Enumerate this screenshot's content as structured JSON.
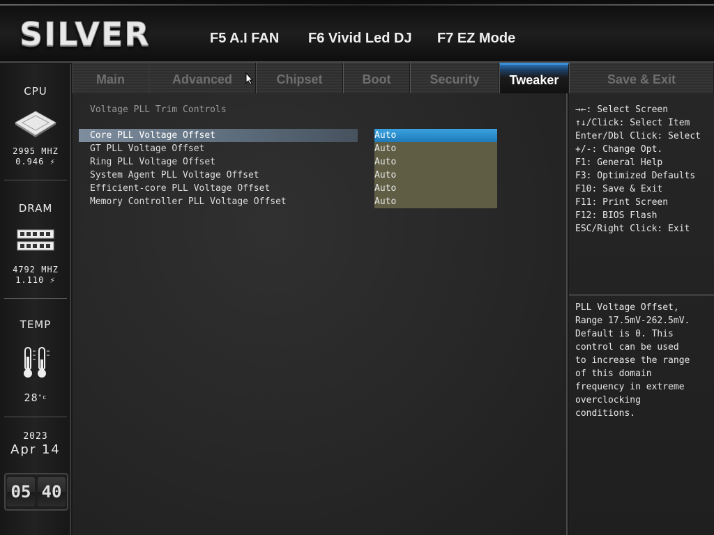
{
  "header": {
    "logo": "SILVER",
    "hotkeys": [
      "F5 A.I FAN",
      "F6 Vivid Led DJ",
      "F7 EZ Mode"
    ]
  },
  "sidebar": {
    "cpu": {
      "label": "CPU",
      "freq": "2995 MHZ",
      "volt": "0.946"
    },
    "dram": {
      "label": "DRAM",
      "freq": "4792 MHZ",
      "volt": "1.110"
    },
    "temp": {
      "label": "TEMP",
      "value": "28"
    },
    "date": {
      "year": "2023",
      "month_day": "Apr 14"
    },
    "clock": {
      "hours": "05",
      "minutes": "40"
    },
    "icons": [
      "cpu-chip-icon",
      "dram-module-icon",
      "thermometer-icon",
      "lightning-icon"
    ]
  },
  "tabs": [
    {
      "label": "Main",
      "active": false
    },
    {
      "label": "Advanced",
      "active": false
    },
    {
      "label": "Chipset",
      "active": false
    },
    {
      "label": "Boot",
      "active": false
    },
    {
      "label": "Security",
      "active": false
    },
    {
      "label": "Tweaker",
      "active": true
    },
    {
      "label": "Save & Exit",
      "active": false
    }
  ],
  "main": {
    "section_title": "Voltage PLL Trim Controls",
    "rows": [
      {
        "label": "Core PLL Voltage Offset",
        "value": "Auto",
        "selected": true
      },
      {
        "label": "GT PLL Voltage Offset",
        "value": "Auto",
        "selected": false
      },
      {
        "label": "Ring PLL Voltage Offset",
        "value": "Auto",
        "selected": false
      },
      {
        "label": "System Agent PLL Voltage Offset",
        "value": "Auto",
        "selected": false
      },
      {
        "label": "Efficient-core PLL Voltage Offset",
        "value": "Auto",
        "selected": false
      },
      {
        "label": "Memory Controller PLL Voltage Offset",
        "value": "Auto",
        "selected": false
      }
    ]
  },
  "help": {
    "keys": [
      "→←: Select Screen",
      "↑↓/Click: Select Item",
      "Enter/Dbl Click: Select",
      "+/-: Change Opt.",
      "F1: General Help",
      "F3: Optimized Defaults",
      "F10: Save & Exit",
      "F11: Print Screen",
      "F12: BIOS Flash",
      "ESC/Right Click: Exit"
    ],
    "description": [
      "PLL Voltage Offset,",
      "Range 17.5mV-262.5mV.",
      "Default is 0. This",
      "control can be used",
      "to increase the range",
      "of this domain",
      "frequency in extreme",
      "overclocking",
      "conditions."
    ]
  },
  "colors": {
    "accent_blue": "#1f79b8",
    "value_bg": "#5f5e45",
    "selected_row": "#5b6a79"
  }
}
